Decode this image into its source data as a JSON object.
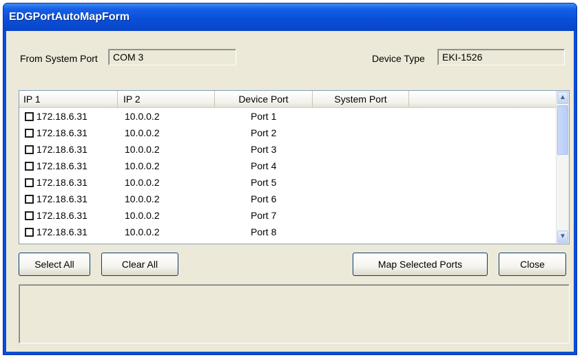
{
  "window": {
    "title": "EDGPortAutoMapForm"
  },
  "form": {
    "from_system_port_label": "From System Port",
    "from_system_port_value": "COM 3",
    "device_type_label": "Device Type",
    "device_type_value": "EKI-1526"
  },
  "list": {
    "columns": [
      "IP 1",
      "IP 2",
      "Device Port",
      "System Port"
    ],
    "rows": [
      {
        "ip1": "172.18.6.31",
        "ip2": "10.0.0.2",
        "device_port": "Port 1",
        "system_port": "",
        "checked": false
      },
      {
        "ip1": "172.18.6.31",
        "ip2": "10.0.0.2",
        "device_port": "Port 2",
        "system_port": "",
        "checked": false
      },
      {
        "ip1": "172.18.6.31",
        "ip2": "10.0.0.2",
        "device_port": "Port 3",
        "system_port": "",
        "checked": false
      },
      {
        "ip1": "172.18.6.31",
        "ip2": "10.0.0.2",
        "device_port": "Port 4",
        "system_port": "",
        "checked": false
      },
      {
        "ip1": "172.18.6.31",
        "ip2": "10.0.0.2",
        "device_port": "Port 5",
        "system_port": "",
        "checked": false
      },
      {
        "ip1": "172.18.6.31",
        "ip2": "10.0.0.2",
        "device_port": "Port 6",
        "system_port": "",
        "checked": false
      },
      {
        "ip1": "172.18.6.31",
        "ip2": "10.0.0.2",
        "device_port": "Port 7",
        "system_port": "",
        "checked": false
      },
      {
        "ip1": "172.18.6.31",
        "ip2": "10.0.0.2",
        "device_port": "Port 8",
        "system_port": "",
        "checked": false
      }
    ]
  },
  "buttons": {
    "select_all": "Select All",
    "clear_all": "Clear All",
    "map_selected_ports": "Map Selected Ports",
    "close": "Close"
  },
  "icons": {
    "scroll_up": "chevron-up-icon",
    "scroll_down": "chevron-down-icon"
  },
  "colors": {
    "titlebar": "#0a4fd8",
    "dialog_background": "#ece9d8"
  }
}
